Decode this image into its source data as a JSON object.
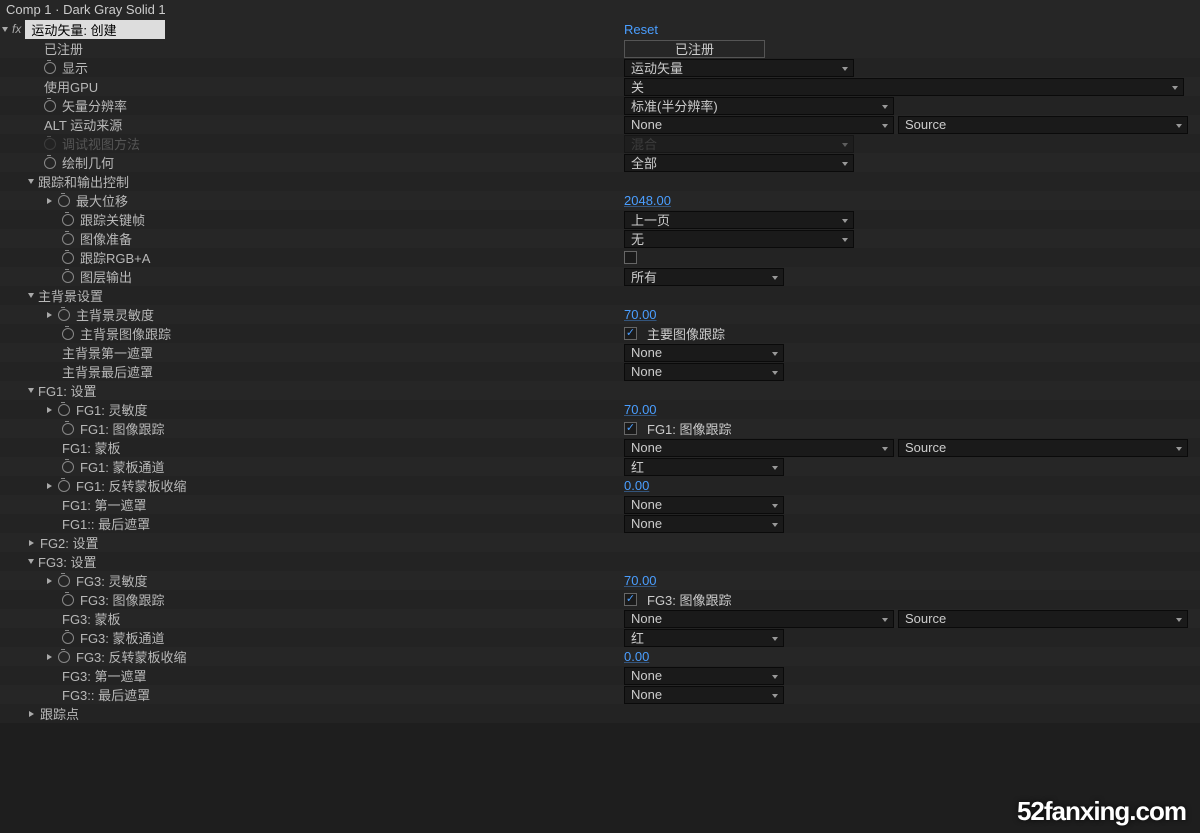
{
  "header": "Comp 1 · Dark Gray Solid 1",
  "fx": {
    "name": "运动矢量: 创建",
    "reset": "Reset"
  },
  "p": {
    "registered_label": "已注册",
    "registered_value": "已注册",
    "display_label": "显示",
    "display_value": "运动矢量",
    "gpu_label": "使用GPU",
    "gpu_value": "关",
    "vecres_label": "矢量分辨率",
    "vecres_value": "标准(半分辨率)",
    "alt_label": "ALT 运动来源",
    "alt_value": "None",
    "alt_source": "Source",
    "debug_label": "调试视图方法",
    "debug_value": "混合",
    "geom_label": "绘制几何",
    "geom_value": "全部",
    "track_header": "跟踪和输出控制",
    "maxdisp_label": "最大位移",
    "maxdisp_value": "2048.00",
    "trackkey_label": "跟踪关键帧",
    "trackkey_value": "上一页",
    "imgprep_label": "图像准备",
    "imgprep_value": "无",
    "rgba_label": "跟踪RGB+A",
    "layerout_label": "图层输出",
    "layerout_value": "所有",
    "mainbg_header": "主背景设置",
    "mbg_sens_label": "主背景灵敏度",
    "mbg_sens_value": "70.00",
    "mbg_track_label": "主背景图像跟踪",
    "mbg_track_chklabel": "主要图像跟踪",
    "mbg_m1_label": "主背景第一遮罩",
    "mbg_m1_value": "None",
    "mbg_mL_label": "主背景最后遮罩",
    "mbg_mL_value": "None",
    "fg1_header": "FG1: 设置",
    "fg1_sens_label": "FG1: 灵敏度",
    "fg1_sens_value": "70.00",
    "fg1_track_label": "FG1: 图像跟踪",
    "fg1_track_chklabel": "FG1: 图像跟踪",
    "fg1_matte_label": "FG1: 蒙板",
    "fg1_matte_value": "None",
    "fg1_matte_source": "Source",
    "fg1_chan_label": "FG1: 蒙板通道",
    "fg1_chan_value": "红",
    "fg1_inv_label": "FG1: 反转蒙板收缩",
    "fg1_inv_value": "0.00",
    "fg1_m1_label": "FG1: 第一遮罩",
    "fg1_m1_value": "None",
    "fg1_mL_label": "FG1:: 最后遮罩",
    "fg1_mL_value": "None",
    "fg2_header": "FG2: 设置",
    "fg3_header": "FG3: 设置",
    "fg3_sens_label": "FG3: 灵敏度",
    "fg3_sens_value": "70.00",
    "fg3_track_label": "FG3: 图像跟踪",
    "fg3_track_chklabel": "FG3: 图像跟踪",
    "fg3_matte_label": "FG3: 蒙板",
    "fg3_matte_value": "None",
    "fg3_matte_source": "Source",
    "fg3_chan_label": "FG3: 蒙板通道",
    "fg3_chan_value": "红",
    "fg3_inv_label": "FG3: 反转蒙板收缩",
    "fg3_inv_value": "0.00",
    "fg3_m1_label": "FG3: 第一遮罩",
    "fg3_m1_value": "None",
    "fg3_mL_label": "FG3:: 最后遮罩",
    "fg3_mL_value": "None",
    "trackpt_header": "跟踪点"
  },
  "watermark": "52fanxing.com"
}
